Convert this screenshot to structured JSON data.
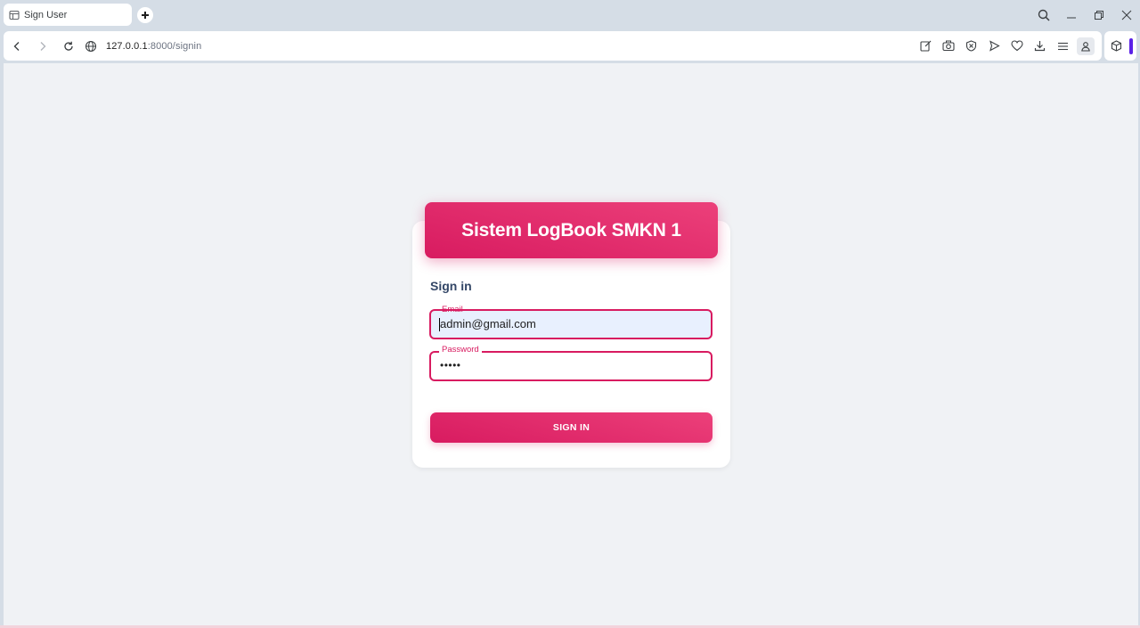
{
  "browser": {
    "tab_title": "Sign User",
    "url_host": "127.0.0.1",
    "url_rest": ":8000/signin",
    "accent_color": "#5b21e6"
  },
  "page": {
    "title": "Sistem LogBook SMKN 1",
    "signin_heading": "Sign in",
    "email": {
      "label": "Email",
      "value": "admin@gmail.com"
    },
    "password": {
      "label": "Password",
      "value": "•••••"
    },
    "submit_label": "SIGN IN",
    "accent_color": "#d81b60"
  },
  "icons": {
    "tab": "site-icon",
    "new_tab": "plus-icon",
    "nav": [
      "back-icon",
      "forward-icon",
      "reload-icon"
    ],
    "site_info": "globe-icon",
    "toolbar": [
      "edit-icon",
      "camera-icon",
      "shield-icon",
      "send-icon",
      "heart-icon",
      "download-icon",
      "menu-icon",
      "profile-icon"
    ],
    "window": [
      "search-icon",
      "minimize-icon",
      "restore-icon",
      "close-icon"
    ],
    "side_panel": "cube-icon"
  }
}
